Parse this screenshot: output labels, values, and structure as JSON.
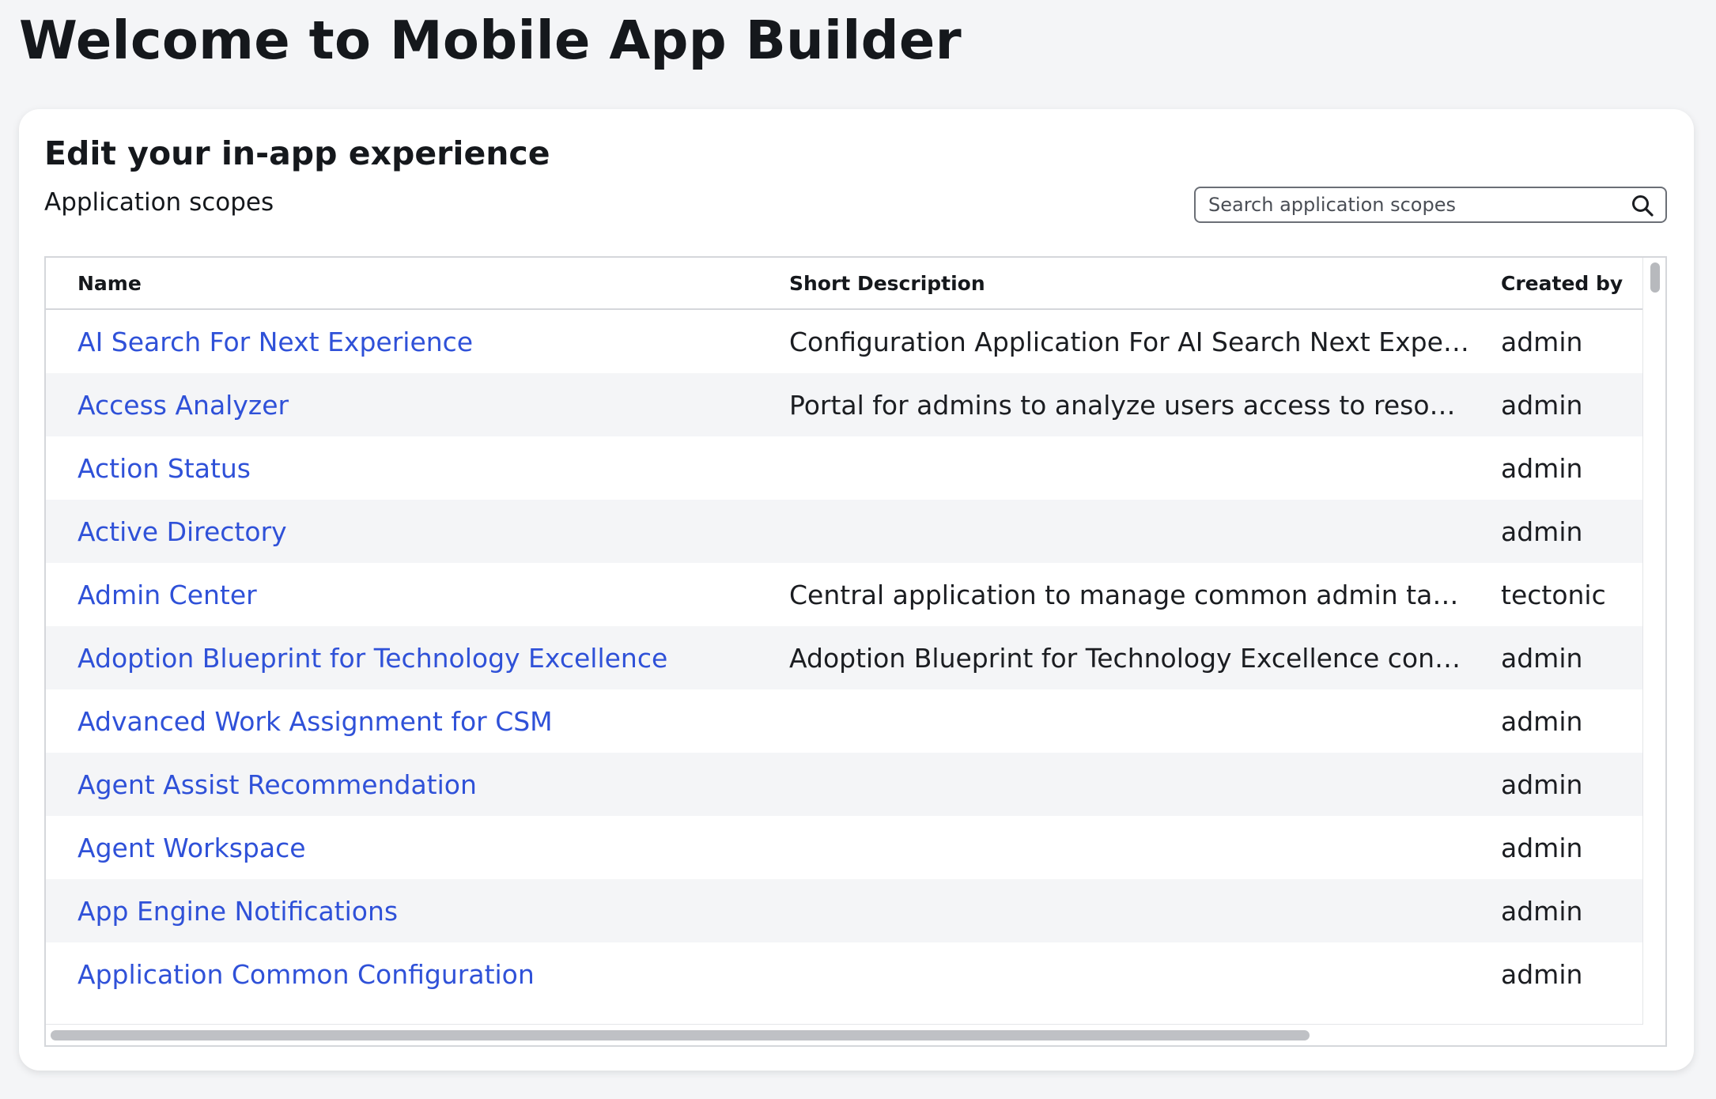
{
  "page": {
    "title": "Welcome to Mobile App Builder"
  },
  "card": {
    "title": "Edit your in-app experience",
    "section_title": "Application scopes"
  },
  "search": {
    "placeholder": "Search application scopes",
    "value": "",
    "icon": "search-icon"
  },
  "table": {
    "columns": [
      "Name",
      "Short Description",
      "Created by"
    ],
    "rows": [
      {
        "name": "AI Search For Next Experience",
        "description": "Configuration Application For AI Search Next Experience",
        "created_by": "admin"
      },
      {
        "name": "Access Analyzer",
        "description": "Portal for admins to analyze users access to resources",
        "created_by": "admin"
      },
      {
        "name": "Action Status",
        "description": "",
        "created_by": "admin"
      },
      {
        "name": "Active Directory",
        "description": "",
        "created_by": "admin"
      },
      {
        "name": "Admin Center",
        "description": "Central application to manage common admin tasks",
        "created_by": "tectonic"
      },
      {
        "name": "Adoption Blueprint for Technology Excellence",
        "description": "Adoption Blueprint for Technology Excellence content p...",
        "created_by": "admin"
      },
      {
        "name": "Advanced Work Assignment for CSM",
        "description": "",
        "created_by": "admin"
      },
      {
        "name": "Agent Assist Recommendation",
        "description": "",
        "created_by": "admin"
      },
      {
        "name": "Agent Workspace",
        "description": "",
        "created_by": "admin"
      },
      {
        "name": "App Engine Notifications",
        "description": "",
        "created_by": "admin"
      },
      {
        "name": "Application Common Configuration",
        "description": "",
        "created_by": "admin"
      }
    ]
  },
  "colors": {
    "link": "#2f51d8",
    "stripe": "#f4f5f7",
    "background": "#f4f5f7"
  }
}
